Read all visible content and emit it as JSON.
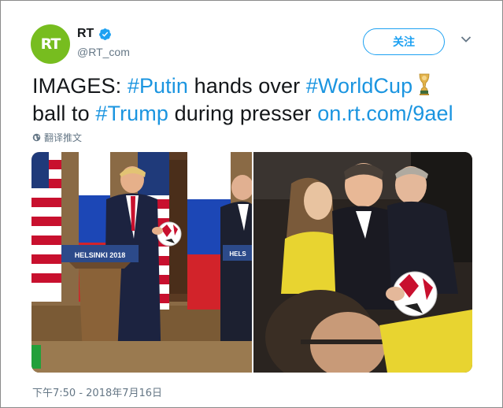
{
  "account": {
    "avatar_text": "RT",
    "name": "RT",
    "handle": "@RT_com",
    "follow_label": "关注"
  },
  "tweet": {
    "t1": "IMAGES: ",
    "tag_putin": "#Putin",
    "t2": " hands over ",
    "tag_worldcup": "#WorldCup",
    "t3": "ball to ",
    "tag_trump": "#Trump",
    "t4": " during presser ",
    "link": "on.rt.com/9ael"
  },
  "translate_label": "翻译推文",
  "photos": {
    "podium_left": "HELSINKI 2018",
    "podium_right": "HELS"
  },
  "timestamp": "下午7:50 - 2018年7月16日",
  "colors": {
    "accent": "#1da1f2",
    "link": "#1b95e0",
    "avatar": "#77bd1f",
    "text": "#14171a",
    "muted": "#657786"
  },
  "icons": [
    "verified-badge-icon",
    "chevron-down-icon",
    "trophy-icon",
    "globe-icon"
  ]
}
